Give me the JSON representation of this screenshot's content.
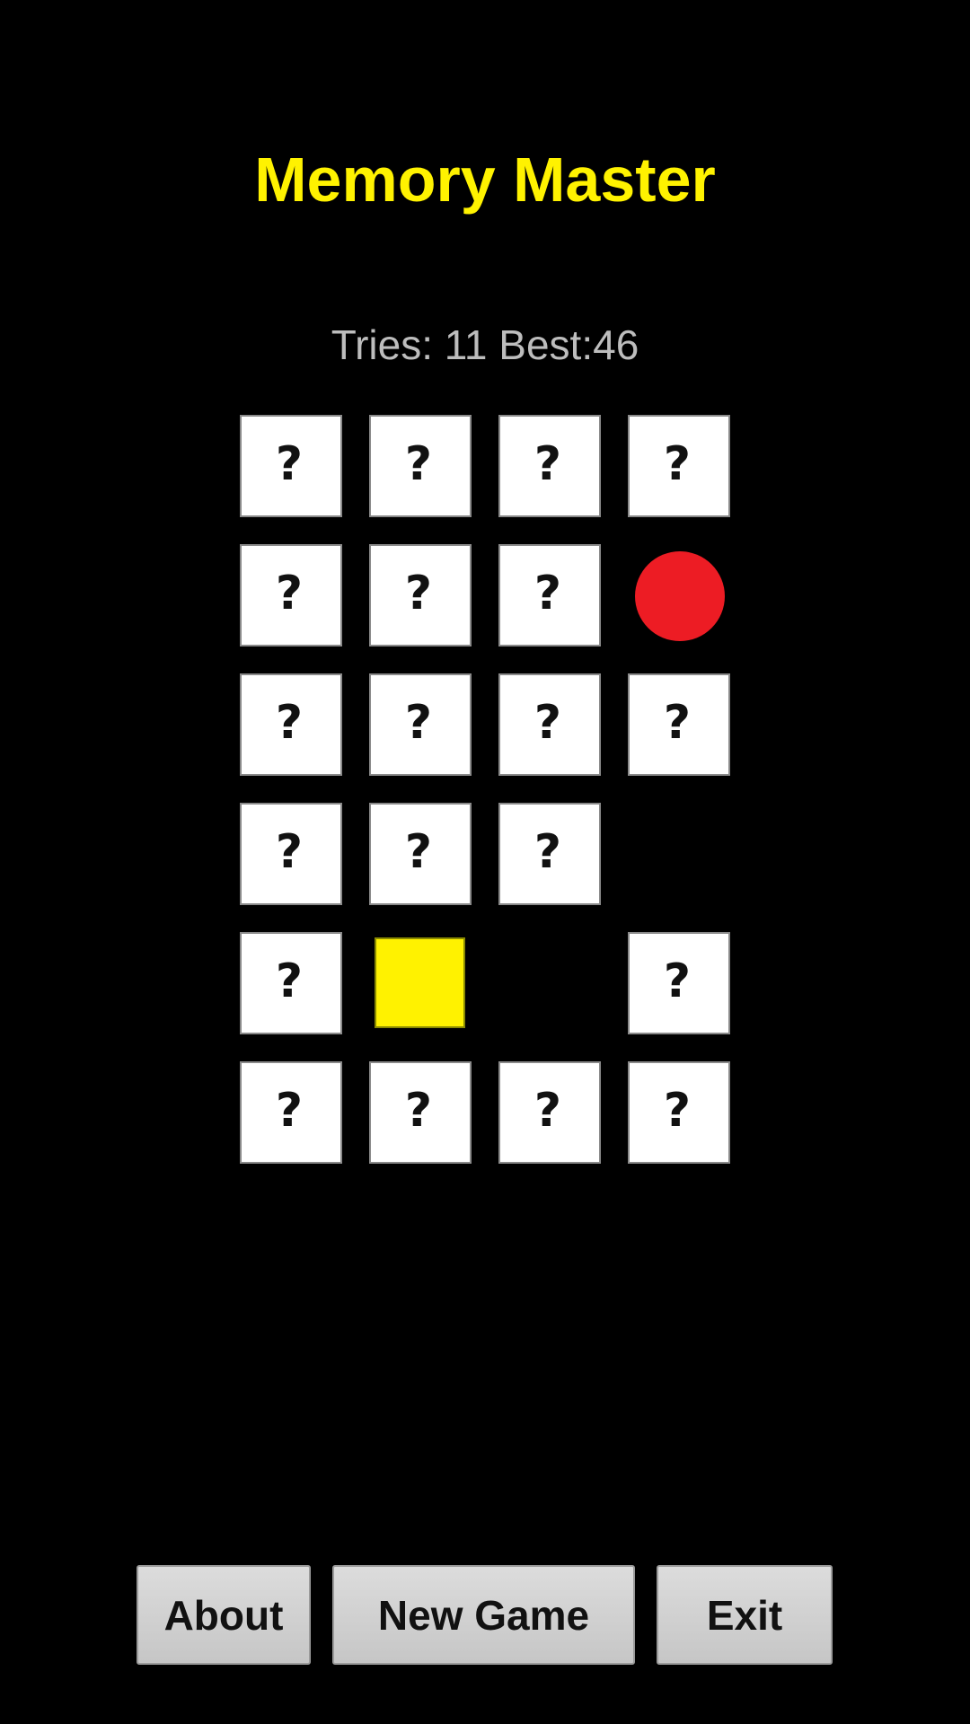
{
  "app": {
    "title": "Memory Master",
    "title_color": "#FFF200",
    "status_color": "#BDBDBD",
    "background": "#000000"
  },
  "status": {
    "tries_label": "Tries:",
    "tries": 11,
    "best_label": "Best:",
    "best": 46,
    "text": "Tries: 11 Best:46"
  },
  "board": {
    "columns": 4,
    "rows": 6,
    "hidden_glyph": "?",
    "cells": [
      {
        "state": "hidden"
      },
      {
        "state": "hidden"
      },
      {
        "state": "hidden"
      },
      {
        "state": "hidden"
      },
      {
        "state": "hidden"
      },
      {
        "state": "hidden"
      },
      {
        "state": "hidden"
      },
      {
        "state": "revealed",
        "shape": "circle",
        "color": "#ED1C24"
      },
      {
        "state": "hidden"
      },
      {
        "state": "hidden"
      },
      {
        "state": "hidden"
      },
      {
        "state": "hidden"
      },
      {
        "state": "hidden"
      },
      {
        "state": "hidden"
      },
      {
        "state": "hidden"
      },
      {
        "state": "empty"
      },
      {
        "state": "hidden"
      },
      {
        "state": "revealed",
        "shape": "square",
        "color": "#FFF200"
      },
      {
        "state": "empty"
      },
      {
        "state": "hidden"
      },
      {
        "state": "hidden"
      },
      {
        "state": "hidden"
      },
      {
        "state": "hidden"
      },
      {
        "state": "hidden"
      }
    ]
  },
  "buttons": {
    "about": "About",
    "new_game": "New Game",
    "exit": "Exit"
  }
}
